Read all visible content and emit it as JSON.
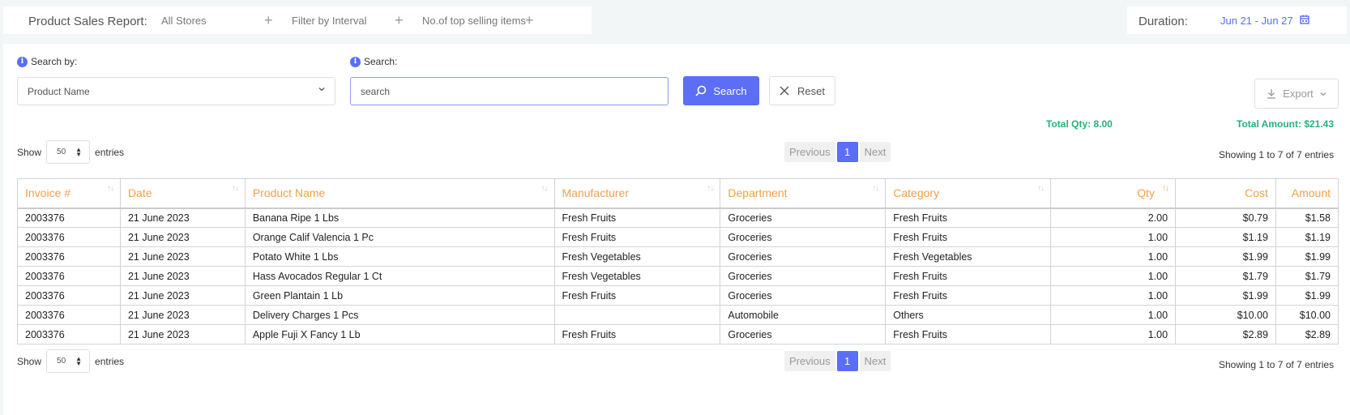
{
  "header": {
    "title": "Product Sales Report:",
    "filters": [
      "All Stores",
      "Filter by Interval",
      "No.of top selling items"
    ],
    "duration_label": "Duration:",
    "duration_value": "Jun 21 - Jun 27"
  },
  "search": {
    "by_label": "Search by:",
    "by_value": "Product Name",
    "label": "Search:",
    "placeholder": "search",
    "search_button": "Search",
    "reset_button": "Reset",
    "export_button": "Export"
  },
  "totals": {
    "qty": "Total Qty: 8.00",
    "amount": "Total Amount: $21.43"
  },
  "paging": {
    "show": "Show",
    "entries_value": "50",
    "entries": "entries",
    "previous": "Previous",
    "page": "1",
    "next": "Next",
    "showing": "Showing 1 to 7 of 7 entries"
  },
  "table": {
    "columns": [
      "Invoice #",
      "Date",
      "Product Name",
      "Manufacturer",
      "Department",
      "Category",
      "Qty",
      "Cost",
      "Amount"
    ],
    "rows": [
      [
        "2003376",
        "21 June 2023",
        "Banana Ripe 1 Lbs",
        "Fresh Fruits",
        "Groceries",
        "Fresh Fruits",
        "2.00",
        "$0.79",
        "$1.58"
      ],
      [
        "2003376",
        "21 June 2023",
        "Orange Calif Valencia 1 Pc",
        "Fresh Fruits",
        "Groceries",
        "Fresh Fruits",
        "1.00",
        "$1.19",
        "$1.19"
      ],
      [
        "2003376",
        "21 June 2023",
        "Potato White 1 Lbs",
        "Fresh Vegetables",
        "Groceries",
        "Fresh Vegetables",
        "1.00",
        "$1.99",
        "$1.99"
      ],
      [
        "2003376",
        "21 June 2023",
        "Hass Avocados Regular 1 Ct",
        "Fresh Vegetables",
        "Groceries",
        "Fresh Fruits",
        "1.00",
        "$1.79",
        "$1.79"
      ],
      [
        "2003376",
        "21 June 2023",
        "Green Plantain 1 Lb",
        "Fresh Fruits",
        "Groceries",
        "Fresh Fruits",
        "1.00",
        "$1.99",
        "$1.99"
      ],
      [
        "2003376",
        "21 June 2023",
        "Delivery Charges 1 Pcs",
        "",
        "Automobile",
        "Others",
        "1.00",
        "$10.00",
        "$10.00"
      ],
      [
        "2003376",
        "21 June 2023",
        "Apple Fuji X Fancy 1 Lb",
        "Fresh Fruits",
        "Groceries",
        "Fresh Fruits",
        "1.00",
        "$2.89",
        "$2.89"
      ]
    ]
  },
  "colors": {
    "accent": "#5b6ef5",
    "header_text": "#f0a04b",
    "totals": "#23b27a"
  }
}
